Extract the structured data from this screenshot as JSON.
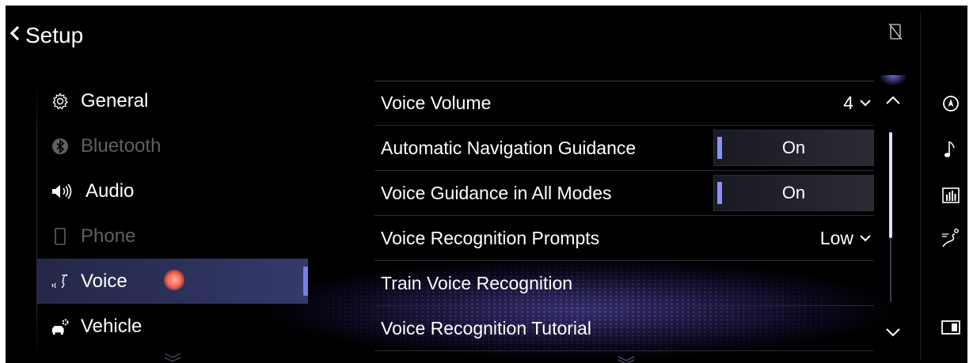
{
  "header": {
    "title": "Setup",
    "back_icon": "chevron-left-icon",
    "status_icon": "phone-disconnected-icon"
  },
  "menu": {
    "items": [
      {
        "label": "General",
        "icon": "gear-icon",
        "state": "normal"
      },
      {
        "label": "Bluetooth",
        "icon": "bluetooth-icon",
        "state": "disabled"
      },
      {
        "label": "Audio",
        "icon": "speaker-icon",
        "state": "normal"
      },
      {
        "label": "Phone",
        "icon": "phone-icon",
        "state": "disabled"
      },
      {
        "label": "Voice",
        "icon": "voice-icon",
        "state": "selected"
      },
      {
        "label": "Vehicle",
        "icon": "vehicle-settings-icon",
        "state": "normal"
      }
    ]
  },
  "settings": {
    "rows": [
      {
        "label": "Voice Volume",
        "value": "4",
        "kind": "dropdown"
      },
      {
        "label": "Automatic Navigation Guidance",
        "value": "On",
        "kind": "toggle"
      },
      {
        "label": "Voice Guidance in All Modes",
        "value": "On",
        "kind": "toggle"
      },
      {
        "label": "Voice Recognition Prompts",
        "value": "Low",
        "kind": "dropdown"
      },
      {
        "label": "Train Voice Recognition",
        "value": "",
        "kind": "action"
      },
      {
        "label": "Voice Recognition Tutorial",
        "value": "",
        "kind": "action"
      }
    ]
  },
  "scrollbar": {
    "position": 0.0,
    "visible_fraction": 0.62
  },
  "rail": {
    "icons": [
      "compass-icon",
      "music-note-icon",
      "equalizer-icon",
      "route-icon",
      "split-screen-icon"
    ]
  },
  "colors": {
    "accent": "#8c8fff",
    "selected_bg": "#2f3460",
    "disabled_text": "#5f5f66",
    "background": "#000000"
  }
}
